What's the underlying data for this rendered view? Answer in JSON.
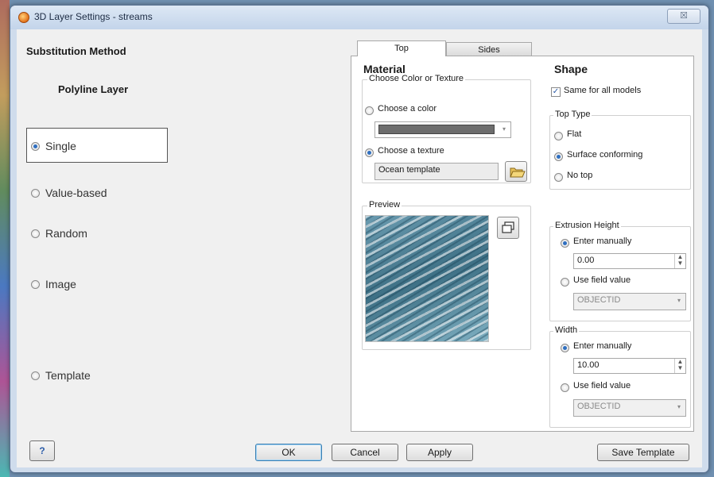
{
  "window": {
    "title": "3D Layer Settings - streams",
    "close_label": "☒"
  },
  "left": {
    "heading": "Substitution Method",
    "subheading": "Polyline Layer",
    "options": [
      {
        "label": "Single",
        "selected": true
      },
      {
        "label": "Value-based",
        "selected": false
      },
      {
        "label": "Random",
        "selected": false
      },
      {
        "label": "Image",
        "selected": false
      },
      {
        "label": "Template",
        "selected": false
      }
    ]
  },
  "tabs": [
    {
      "label": "Top",
      "active": true
    },
    {
      "label": "Sides",
      "active": false
    }
  ],
  "material": {
    "heading": "Material",
    "group_title": "Choose Color or Texture",
    "color_option": "Choose a color",
    "color_swatch": "#6d6d6d",
    "texture_option": "Choose a texture",
    "texture_value": "Ocean template",
    "preview_title": "Preview"
  },
  "shape": {
    "heading": "Shape",
    "same_for_all": "Same for all models",
    "same_for_all_checked": true,
    "top_type_title": "Top Type",
    "top_types": [
      {
        "label": "Flat",
        "selected": false
      },
      {
        "label": "Surface conforming",
        "selected": true
      },
      {
        "label": "No top",
        "selected": false
      }
    ],
    "extrusion": {
      "title": "Extrusion Height",
      "enter_manually": "Enter manually",
      "value": "0.00",
      "use_field": "Use field value",
      "field": "OBJECTID"
    },
    "width": {
      "title": "Width",
      "enter_manually": "Enter manually",
      "value": "10.00",
      "use_field": "Use field value",
      "field": "OBJECTID"
    }
  },
  "buttons": {
    "help": "?",
    "ok": "OK",
    "cancel": "Cancel",
    "apply": "Apply",
    "save_template": "Save Template"
  },
  "colors": {
    "accent": "#2f6fc0",
    "window_frame": "#cfdcec",
    "client_bg": "#f0f0f0"
  }
}
